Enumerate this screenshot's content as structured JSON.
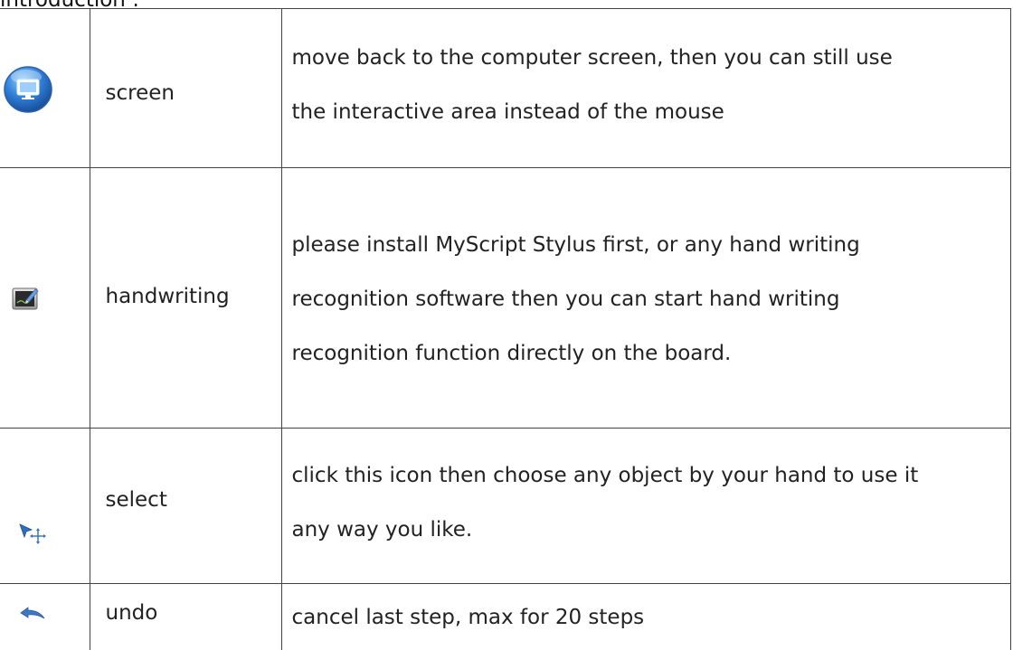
{
  "heading": "introduction :",
  "rows": [
    {
      "icon": "screen-icon",
      "name": "screen",
      "lines": [
        "move back to the computer screen, then you can still use",
        "the interactive area instead of the mouse"
      ]
    },
    {
      "icon": "handwriting-icon",
      "name": "handwriting",
      "lines": [
        "please install MyScript Stylus first, or any hand writing",
        "recognition software then you can start hand writing",
        "recognition function directly on the board."
      ]
    },
    {
      "icon": "select-icon",
      "name": "select",
      "lines": [
        "click this icon then choose any object by your hand to use it",
        "any way you like."
      ]
    },
    {
      "icon": "undo-icon",
      "name": "undo",
      "lines": [
        "cancel last step, max for 20 steps"
      ]
    }
  ],
  "colors": {
    "screen_icon_blue": "#2f7fd8",
    "select_icon_blue": "#2f6fbf",
    "undo_icon_blue": "#3f78c4",
    "border": "#444444"
  }
}
